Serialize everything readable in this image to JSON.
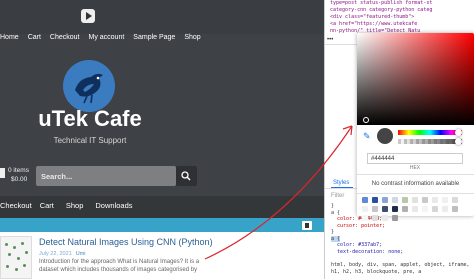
{
  "site": {
    "topnav": [
      "Home",
      "Cart",
      "Checkout",
      "My account",
      "Sample Page",
      "Shop"
    ],
    "brand": "uTek Cafe",
    "tagline": "Technical IT Support",
    "cart_items": "0 items",
    "cart_total": "$0.00",
    "search_placeholder": "Search...",
    "mainnav": [
      "Checkout",
      "Cart",
      "Shop",
      "Downloads"
    ],
    "post": {
      "title": "Detect Natural Images Using CNN (Python)",
      "date": "July 22, 2021",
      "author": "Umi",
      "excerpt": "Introduction for the approach What is Natural Images? It is a dataset which includes thousands of images categorised by"
    }
  },
  "devtools": {
    "code_lines": [
      "type=post status-publish format-st",
      "category-cnn category-python categ",
      "<div class=\"featured-thumb\">",
      "<a href=\"https://www.utekcafe",
      "nn-python/\" title=\"Detect Natu"
    ],
    "styles_tab": "Styles",
    "filter_placeholder": "Filter",
    "css_lines": [
      "}",
      "a {",
      "  color: #444444;",
      "  cursor: pointer;",
      "}",
      "a {",
      "  color: #337ab7;",
      "  text-decoration: none;"
    ],
    "inherited": "html, body, div, span, applet, object, iframe, h1, h2, h3, blockquote, pre, a"
  },
  "picker": {
    "hex_value": "#444444",
    "hex_label": "HEX",
    "no_contrast": "No contrast information available",
    "palette": [
      "#5b8ad6",
      "#2a4fa0",
      "#89a5d4",
      "#d0d8e6",
      "#b7c9a6",
      "#dfe3db",
      "#c9c9c9",
      "#e9e9e9",
      "#f0f0f0",
      "#dadada",
      "#efefef",
      "#c5c5c5",
      "#3d4e6e",
      "#1f2c47",
      "#b0b0b0",
      "#e8e8e8",
      "#f4f4f4",
      "#d6d6d6",
      "#ececec",
      "#bfbfbf",
      "#f6f6f6",
      "#dedede",
      "#eaeaea",
      "#9a9a9a"
    ],
    "colors": {
      "swatch": "#444444",
      "accent": "#1a73e8",
      "arrow": "#d9262c"
    }
  }
}
